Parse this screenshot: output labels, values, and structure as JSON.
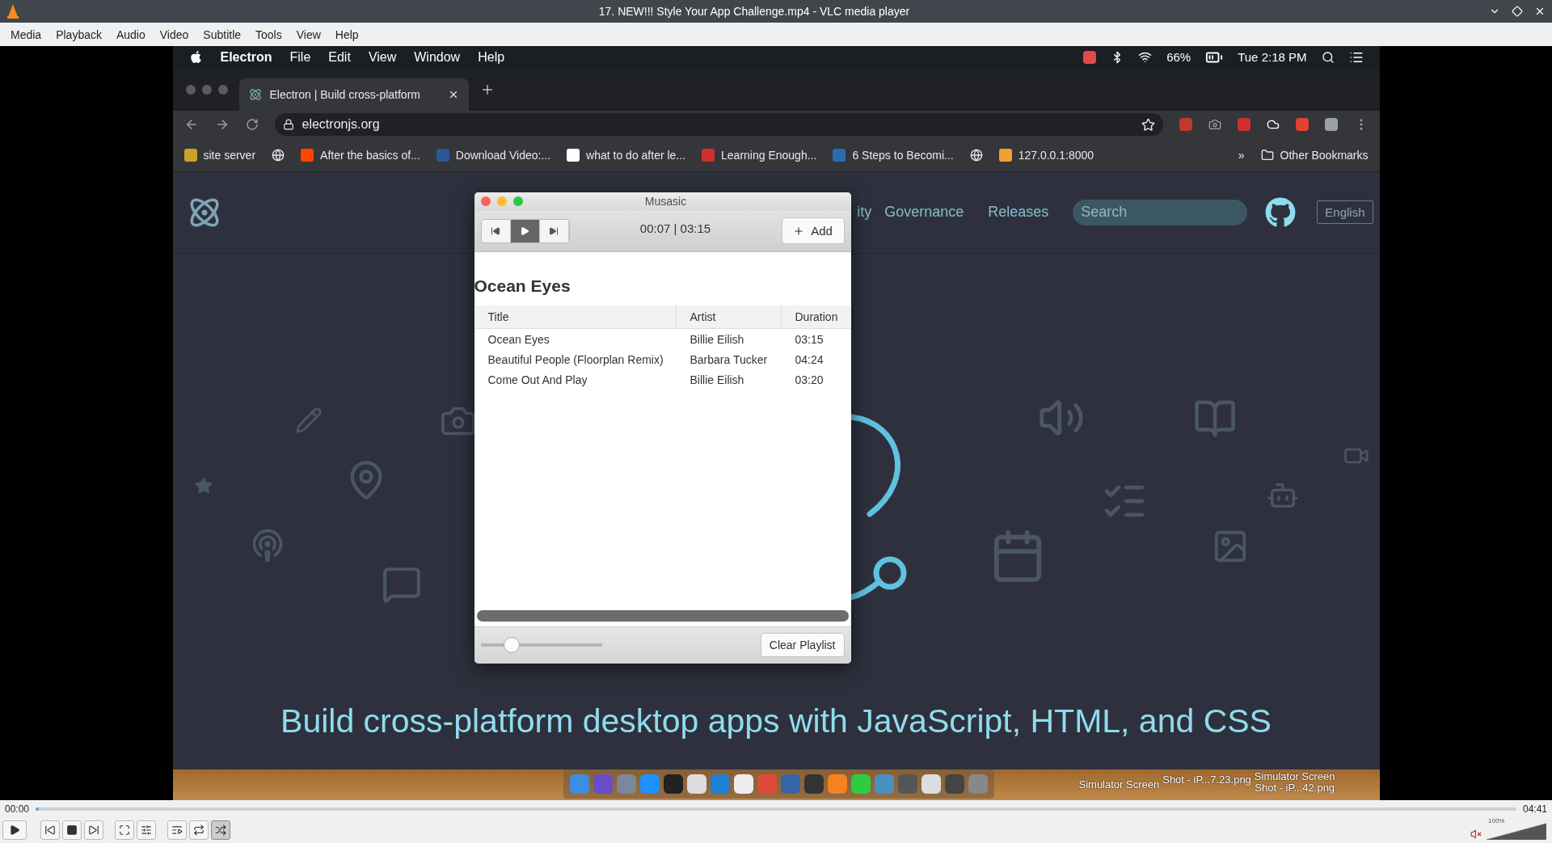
{
  "window": {
    "title": "17. NEW!!! Style Your App Challenge.mp4 - VLC media player"
  },
  "menu": [
    "Media",
    "Playback",
    "Audio",
    "Video",
    "Subtitle",
    "Tools",
    "View",
    "Help"
  ],
  "video": {
    "mac_menubar": {
      "app_menus": [
        "Electron",
        "File",
        "Edit",
        "View",
        "Window",
        "Help"
      ],
      "battery": "66%",
      "clock": "Tue 2:18 PM"
    },
    "browser": {
      "tabs": [
        {
          "title": "Electron | Build cross-platform",
          "selected": true
        }
      ],
      "address": "electronjs.org",
      "bookmarks": [
        {
          "kind": "grid",
          "label": "site server"
        },
        {
          "kind": "globe"
        },
        {
          "kind": "reddit",
          "label": "After the basics of..."
        },
        {
          "kind": "w",
          "label": "Download Video:..."
        },
        {
          "kind": "google",
          "label": "what to do after le..."
        },
        {
          "kind": "red",
          "label": "Learning Enough..."
        },
        {
          "kind": "z",
          "label": "6 Steps to Becomi..."
        },
        {
          "kind": "globe"
        },
        {
          "kind": "torch",
          "label": "127.0.0.1:8000"
        }
      ],
      "overflow": "»",
      "other_bookmarks": "Other Bookmarks"
    },
    "page": {
      "nav": [
        "ity",
        "Governance",
        "Releases"
      ],
      "search": {
        "placeholder": "Search"
      },
      "language": "English",
      "headline": "Build cross-platform desktop apps with JavaScript, HTML, and CSS"
    },
    "player": {
      "title": "Musasic",
      "transport": [
        {
          "kind": "previous",
          "selected": false
        },
        {
          "kind": "play",
          "selected": true
        },
        {
          "kind": "next",
          "selected": false
        }
      ],
      "time": "00:07 | 03:15",
      "add": "Add",
      "heading": "Ocean Eyes",
      "columns": [
        "Title",
        "Artist",
        "Duration"
      ],
      "rows": [
        {
          "title": "Ocean Eyes",
          "artist": "Billie Eilish",
          "duration": "03:15"
        },
        {
          "title": "Beautiful People (Floorplan Remix)",
          "artist": "Barbara Tucker",
          "duration": "04:24"
        },
        {
          "title": "Come Out And Play",
          "artist": "Billie Eilish",
          "duration": "03:20"
        }
      ],
      "volume": {
        "level": 0.22
      },
      "clear": "Clear Playlist"
    },
    "desktop_labels": [
      "Simulator Screen",
      "Shot - iP...7.23.png",
      "Simulator Screen",
      "Shot - iP...42.png"
    ]
  },
  "controls": {
    "elapsed": "00:00",
    "total": "04:41",
    "seek": {
      "level": 0
    },
    "buttons": [
      {
        "kind": "play",
        "on": false
      },
      {
        "kind": "previous",
        "on": false
      },
      {
        "kind": "stop",
        "on": false
      },
      {
        "kind": "next",
        "on": false
      },
      {
        "kind": "fullscreen",
        "on": false
      },
      {
        "kind": "settings",
        "on": false
      },
      {
        "kind": "playlist",
        "on": false
      },
      {
        "kind": "loop",
        "on": false
      },
      {
        "kind": "shuffle",
        "on": true
      }
    ],
    "volume": {
      "level": 1,
      "reading": "100%",
      "muted": true
    }
  }
}
